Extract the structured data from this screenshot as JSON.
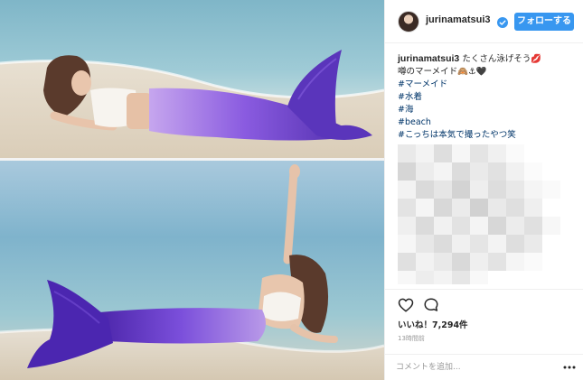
{
  "post": {
    "username": "jurinamatsui3",
    "follow_label": "フォローする",
    "caption": {
      "user": "jurinamatsui3",
      "line1": "たくさん泳げそう💋",
      "line2": "噂のマーメイド🙈⚓🖤",
      "hashtags": [
        "#マーメイド",
        "#水着",
        "#海",
        "#beach",
        "#こっちは本気で撮ったやつ笑"
      ]
    },
    "likes_label": "いいね！7,294件",
    "time_ago": "13時間前",
    "comment_placeholder": "コメントを追加..."
  },
  "icons": {
    "verified": "verified-badge-icon",
    "like": "heart-icon",
    "comment": "speech-bubble-icon",
    "more": "ellipsis-icon"
  },
  "colors": {
    "follow_button": "#3897f0",
    "hashtag": "#003569",
    "tail_purple": "#6a3fd0"
  }
}
